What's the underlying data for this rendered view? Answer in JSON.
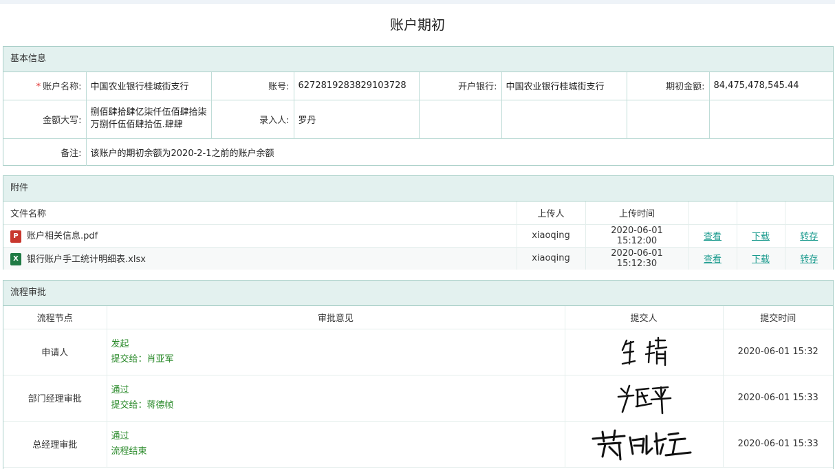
{
  "page_title": "账户期初",
  "basic": {
    "header": "基本信息",
    "required_mark": "*",
    "account_name_label": "账户名称:",
    "account_name": "中国农业银行桂城街支行",
    "account_no_label": "账号:",
    "account_no": "6272819283829103728",
    "bank_label": "开户银行:",
    "bank": "中国农业银行桂城街支行",
    "amount_label": "期初金额:",
    "amount": "84,475,478,545.44",
    "amount_upper_label": "金额大写:",
    "amount_upper": "捌佰肆拾肆亿柒仟伍佰肆拾柒万捌仟伍佰肆拾伍.肆肆",
    "entered_by_label": "录入人:",
    "entered_by": "罗丹",
    "remark_label": "备注:",
    "remark": "该账户的期初余额为2020-2-1之前的账户余额"
  },
  "attachments": {
    "header": "附件",
    "col_filename": "文件名称",
    "col_uploader": "上传人",
    "col_upload_time": "上传时间",
    "files": [
      {
        "icon": "pdf-file-icon",
        "icon_text": "P",
        "name": "账户相关信息.pdf",
        "uploader": "xiaoqing",
        "time": "2020-06-01 15:12:00",
        "view": "查看",
        "download": "下载",
        "transfer": "转存"
      },
      {
        "icon": "excel-file-icon",
        "icon_text": "X",
        "name": "银行账户手工统计明细表.xlsx",
        "uploader": "xiaoqing",
        "time": "2020-06-01 15:12:30",
        "view": "查看",
        "download": "下载",
        "transfer": "转存"
      }
    ]
  },
  "workflow": {
    "header": "流程审批",
    "col_node": "流程节点",
    "col_opinion": "审批意见",
    "col_submitter": "提交人",
    "col_time": "提交时间",
    "rows": [
      {
        "node": "申请人",
        "opinion": "发起",
        "next": "提交给：肖亚军",
        "signature": "肖晴",
        "time": "2020-06-01 15:32"
      },
      {
        "node": "部门经理审批",
        "opinion": "通过",
        "next": "提交给：蒋德帧",
        "signature": "肖亚军",
        "time": "2020-06-01 15:33"
      },
      {
        "node": "总经理审批",
        "opinion": "通过",
        "next": "流程结束",
        "signature": "蒋德帧",
        "time": "2020-06-01 15:33"
      }
    ]
  },
  "colors": {
    "accent": "#199a8d",
    "panel_header": "#e3f1ef",
    "border": "#a9cfc8",
    "opinion_text": "#2a8a2a"
  }
}
